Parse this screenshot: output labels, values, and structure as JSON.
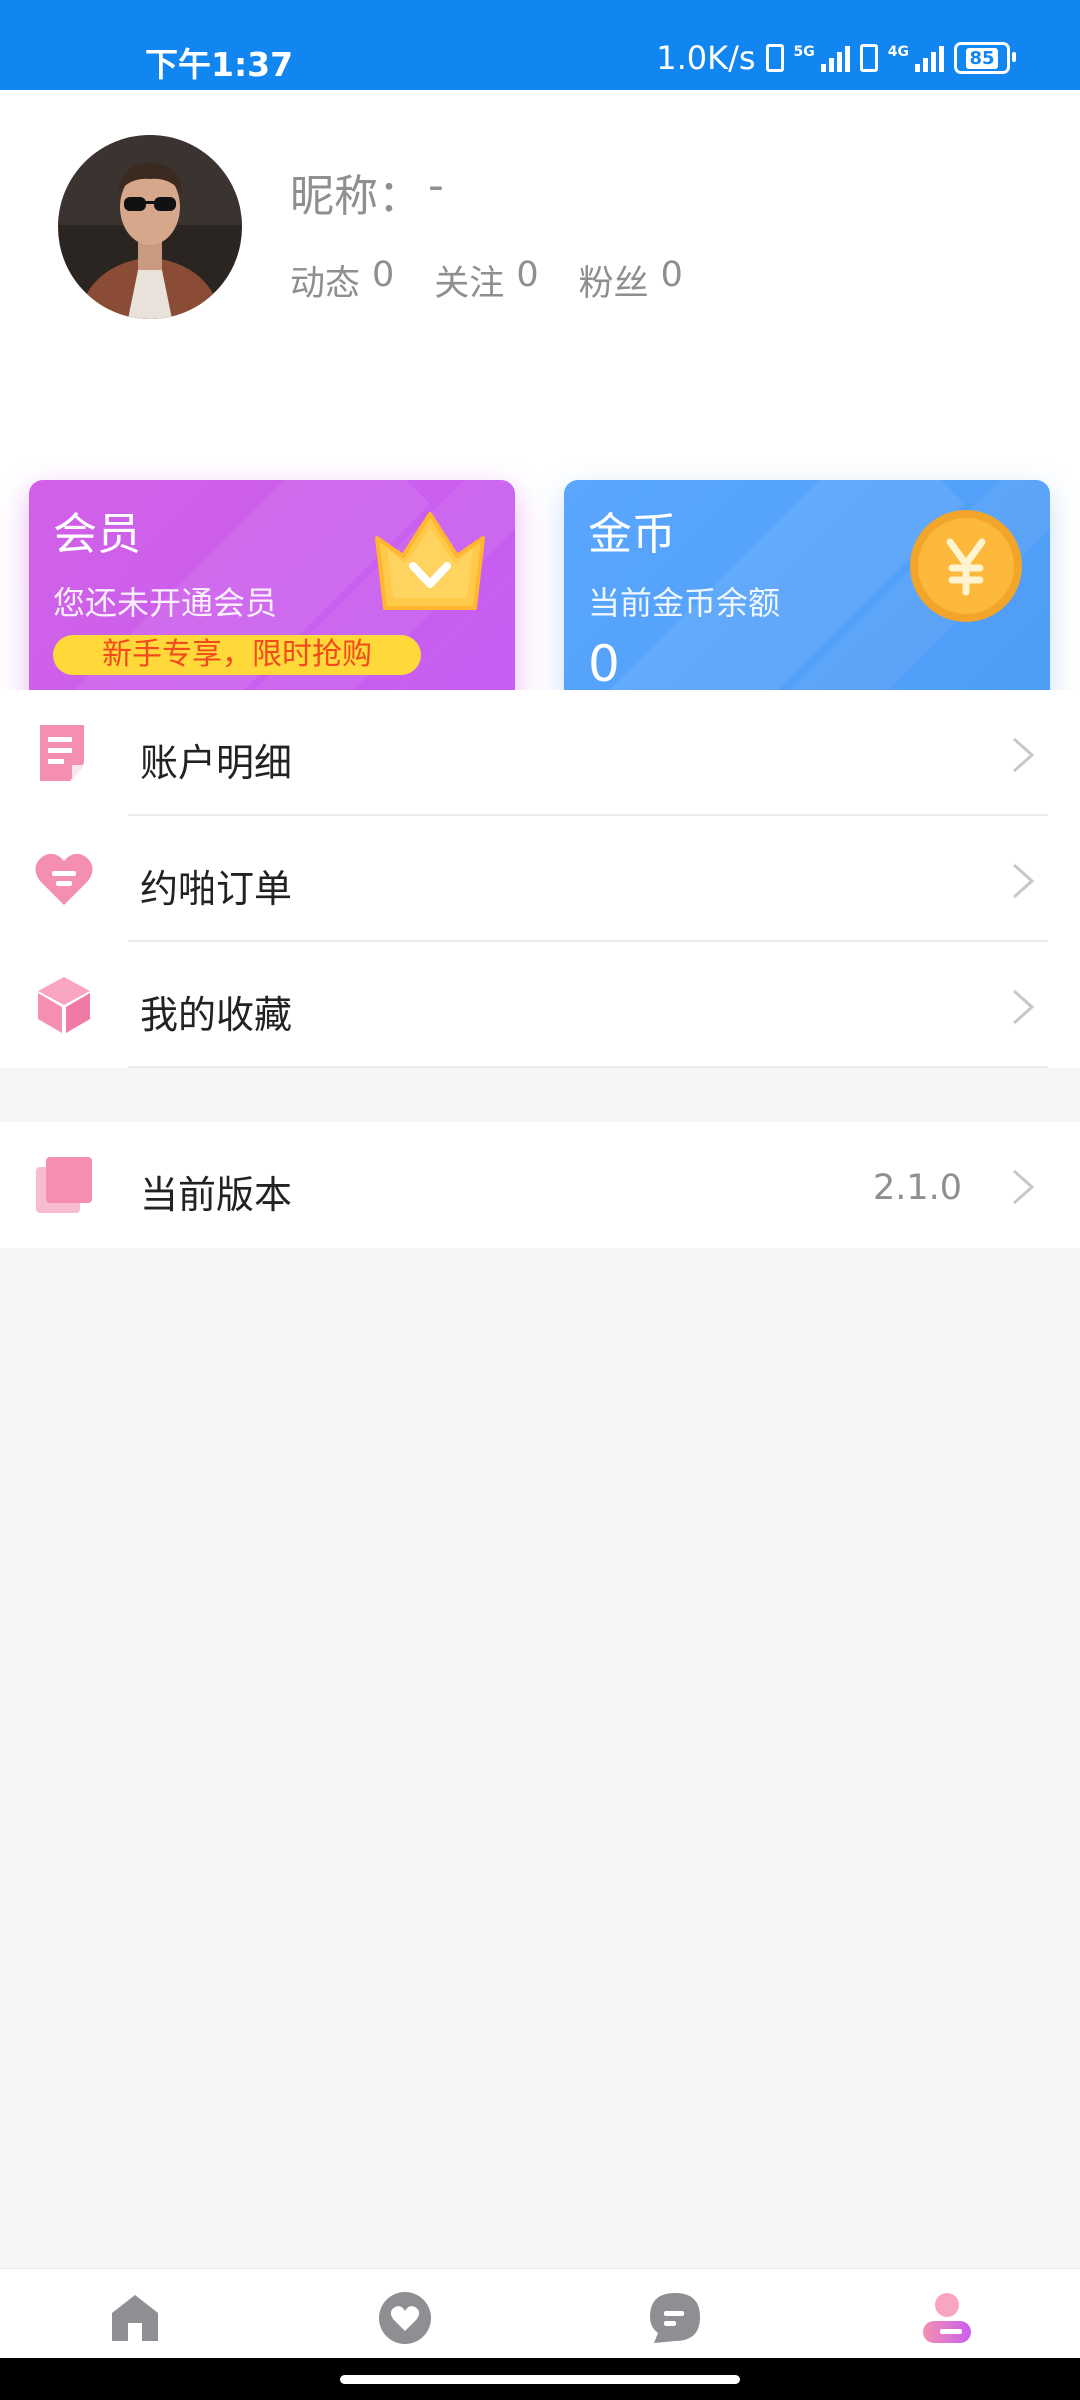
{
  "status_bar": {
    "time": "下午1:37",
    "network_speed": "1.0K/s",
    "sim1_type": "5G",
    "sim2_type": "4G",
    "battery": "85"
  },
  "profile": {
    "nickname_label": "昵称：",
    "nickname_value": "-",
    "stats": [
      {
        "label": "动态",
        "value": "0"
      },
      {
        "label": "关注",
        "value": "0"
      },
      {
        "label": "粉丝",
        "value": "0"
      }
    ]
  },
  "cards": {
    "vip": {
      "title": "会员",
      "subtitle": "您还未开通会员",
      "promo": "新手专享，限时抢购",
      "icon": "crown-icon"
    },
    "coins": {
      "title": "金币",
      "subtitle": "当前金币余额",
      "value": "0",
      "icon": "yuan-coin-icon"
    }
  },
  "menu": [
    {
      "label": "账户明细",
      "icon": "document-icon"
    },
    {
      "label": "约啪订单",
      "icon": "heart-chat-icon"
    },
    {
      "label": "我的收藏",
      "icon": "box-icon"
    }
  ],
  "menu2": [
    {
      "label": "当前版本",
      "value": "2.1.0",
      "icon": "layers-icon"
    }
  ],
  "bottom_nav": [
    {
      "icon": "home-icon",
      "active": false
    },
    {
      "icon": "heart-icon",
      "active": false
    },
    {
      "icon": "chat-icon",
      "active": false
    },
    {
      "icon": "profile-icon",
      "active": true
    }
  ],
  "colors": {
    "status_bar": "#1286f0",
    "accent_pink": "#f48fb1",
    "vip_card": "#cb5fee",
    "coin_card": "#519ff8",
    "promo_bg": "#ffd93a",
    "promo_text": "#f24a1c"
  }
}
